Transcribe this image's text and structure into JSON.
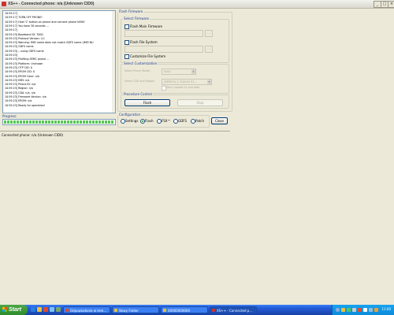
{
  "window": {
    "title": "XS++ - Connected phone: n/a (Unknown CID0)",
    "buttons": {
      "minimize": "_",
      "maximize": "□",
      "close": "×"
    }
  },
  "log": {
    "lines": [
      "10:59:17]",
      "10:59:17] TURN OFF PHONE!",
      "10:59:17] Hold 'C' button on phone and connect phone NOW!",
      "10:59:17] You have 30 seconds ...",
      "10:59:17]",
      "10:59:23] Baseband ID: 7000",
      "10:59:23] Protocol Version: 4.1",
      "10:59:23] Warning: IMEI name does not match GDFS name (IMEI NU",
      "10:59:23] GDFS name",
      "10:59:23] ...using GDFS name",
      "10:59:23]",
      "10:59:23] Profiling SEMC phone ...",
      "10:59:23] Platform: Unknown",
      "10:59:23] OTP CID: 0",
      "10:59:23] EROM CID: 0",
      "10:59:23] EROM Color: n/a",
      "10:59:23] IMEI: n/a",
      "10:59:23] Phone ID: n/a",
      "10:59:23] Region: n/a",
      "10:59:23] CDA: n/a, n/a",
      "10:59:23] Firmware Version: n/a",
      "10:59:23] EROM: n/a",
      "10:59:23] Ready for operation!"
    ]
  },
  "progress": {
    "label": "Progress:",
    "value_fraction": 1.0
  },
  "flash_firmware": {
    "title": "Flash Firmware",
    "select_firmware": {
      "title": "Select Firmware",
      "flash_main_firmware": {
        "label": "Flash Main Firmware",
        "checked": false
      },
      "flash_file_system": {
        "label": "Flash File System",
        "checked": false
      },
      "customize_file_system": {
        "label": "Customize File System",
        "checked": false
      },
      "browse": "..."
    },
    "select_customization": {
      "title": "Select Customization",
      "phone_model_label": "Select Phone Model",
      "phone_model_value": "K500",
      "cda_label": "Select CDA and Region",
      "cda_value": "AMERICA_1 CDA102 R2...",
      "dont_upload_label": "Don't upload GL and data"
    },
    "procedure_control": {
      "title": "Procedure Control",
      "flash": "Flash",
      "stop": "Stop"
    }
  },
  "configuration": {
    "title": "Configuration",
    "options": [
      {
        "label": "Settings",
        "selected": false
      },
      {
        "label": "Flash",
        "selected": true
      },
      {
        "label": "FSX™",
        "selected": false
      },
      {
        "label": "GDFS",
        "selected": false
      },
      {
        "label": "Patch",
        "selected": false
      }
    ],
    "close": "Close"
  },
  "status_bar": {
    "text": "Connected phone: n/a (Unknown CID0)"
  },
  "taskbar": {
    "start": "Start",
    "tasks": [
      {
        "label": "Odpowiadanie w tem...",
        "active": false
      },
      {
        "label": "Nowy Folder",
        "active": false
      },
      {
        "label": "00000000000",
        "active": false
      },
      {
        "label": "XS++ - Connected p...",
        "active": true
      }
    ],
    "clock": "11:00"
  },
  "colors": {
    "window_bg": "#ece9d8",
    "taskbar_blue": "#245edb",
    "start_green": "#3c9a38",
    "progress_green": "#58c655"
  }
}
